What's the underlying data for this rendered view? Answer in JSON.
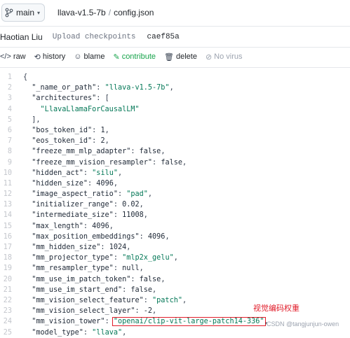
{
  "header": {
    "branch_label": "main",
    "repo": "llava-v1.5-7b",
    "file": "config.json",
    "separator": "/"
  },
  "commit": {
    "author": "Haotian Liu",
    "message": "Upload checkpoints",
    "hash": "caef85a"
  },
  "actions": [
    {
      "icon": "code-icon",
      "glyph": "</>",
      "label": "raw"
    },
    {
      "icon": "history-icon",
      "glyph": "⟲",
      "label": "history"
    },
    {
      "icon": "blame-icon",
      "glyph": "☺",
      "label": "blame"
    },
    {
      "icon": "edit-icon",
      "glyph": "✎",
      "label": "contribute"
    },
    {
      "icon": "trash-icon",
      "glyph": "🗑",
      "label": "delete"
    },
    {
      "icon": "shield-icon",
      "glyph": "⊘",
      "label": "No virus"
    }
  ],
  "code_lines": [
    [
      1,
      "{"
    ],
    [
      2,
      "  \"_name_or_path\": \"llava-v1.5-7b\","
    ],
    [
      3,
      "  \"architectures\": ["
    ],
    [
      4,
      "    \"LlavaLlamaForCausalLM\""
    ],
    [
      5,
      "  ],"
    ],
    [
      6,
      "  \"bos_token_id\": 1,"
    ],
    [
      7,
      "  \"eos_token_id\": 2,"
    ],
    [
      8,
      "  \"freeze_mm_mlp_adapter\": false,"
    ],
    [
      9,
      "  \"freeze_mm_vision_resampler\": false,"
    ],
    [
      10,
      "  \"hidden_act\": \"silu\","
    ],
    [
      11,
      "  \"hidden_size\": 4096,"
    ],
    [
      12,
      "  \"image_aspect_ratio\": \"pad\","
    ],
    [
      13,
      "  \"initializer_range\": 0.02,"
    ],
    [
      14,
      "  \"intermediate_size\": 11008,"
    ],
    [
      15,
      "  \"max_length\": 4096,"
    ],
    [
      16,
      "  \"max_position_embeddings\": 4096,"
    ],
    [
      17,
      "  \"mm_hidden_size\": 1024,"
    ],
    [
      18,
      "  \"mm_projector_type\": \"mlp2x_gelu\","
    ],
    [
      19,
      "  \"mm_resampler_type\": null,"
    ],
    [
      20,
      "  \"mm_use_im_patch_token\": false,"
    ],
    [
      21,
      "  \"mm_use_im_start_end\": false,"
    ],
    [
      22,
      "  \"mm_vision_select_feature\": \"patch\","
    ],
    [
      23,
      "  \"mm_vision_select_layer\": -2,"
    ],
    [
      24,
      "  \"mm_vision_tower\": \"openai/clip-vit-large-patch14-336\","
    ],
    [
      25,
      "  \"model_type\": \"llava\","
    ]
  ],
  "highlight": {
    "line": 24,
    "value": "\"openai/clip-vit-large-patch14-336\"",
    "annotation": "视觉编码权重",
    "color": "#e11d2a"
  },
  "watermark": "CSDN @tangjunjun-owen",
  "colors": {
    "string": "#047857",
    "contribute": "#16a34a",
    "line_number": "#c3c6cc"
  }
}
